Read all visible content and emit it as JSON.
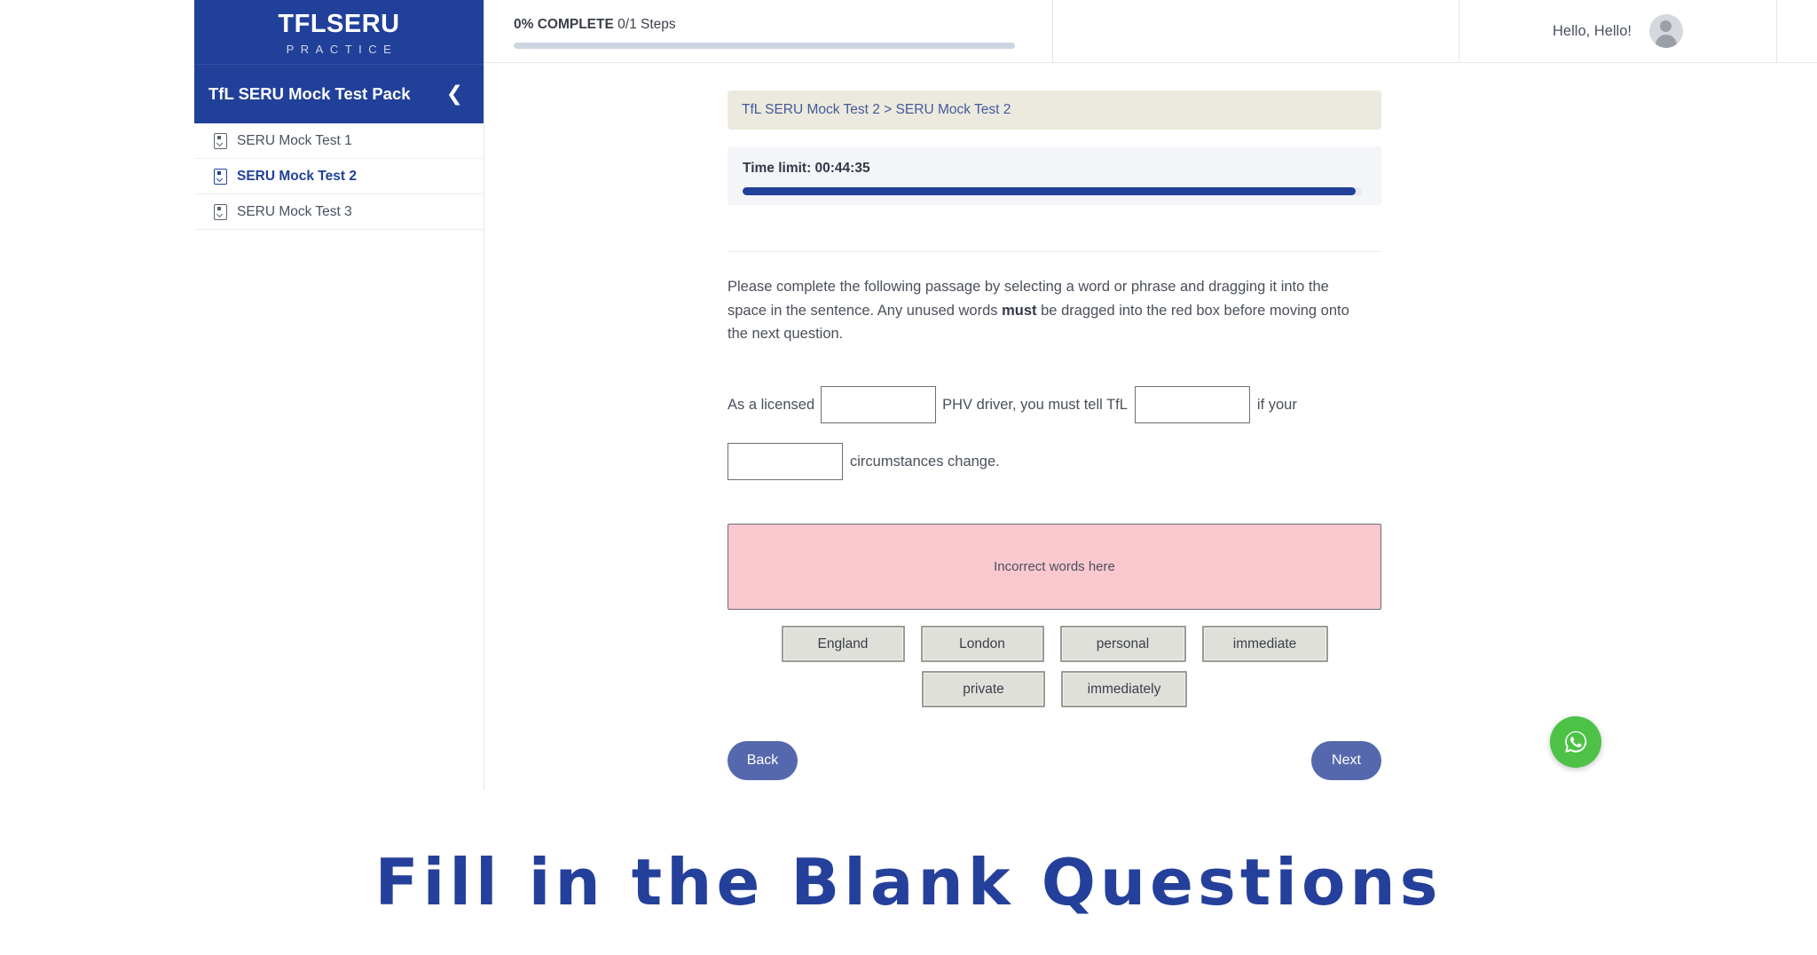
{
  "brand": {
    "name": "TFLSERU",
    "tagline": "PRACTICE"
  },
  "sidebar": {
    "pack_title": "TfL SERU Mock Test Pack",
    "collapse_icon": "chevron-left-icon",
    "items": [
      {
        "label": "SERU Mock Test 1",
        "icon": "document-check-icon",
        "active": false
      },
      {
        "label": "SERU Mock Test 2",
        "icon": "document-check-icon",
        "active": true
      },
      {
        "label": "SERU Mock Test 3",
        "icon": "document-check-icon",
        "active": false
      }
    ]
  },
  "topbar": {
    "progress_percent": "0%",
    "progress_word": "COMPLETE",
    "steps": "0/1 Steps",
    "progress_value": 0,
    "greeting": "Hello, Hello!",
    "avatar_icon": "user-avatar-icon"
  },
  "main": {
    "breadcrumb": "TfL SERU Mock Test 2 > SERU Mock Test 2",
    "timer_label": "Time limit: 00:44:35",
    "timer_progress": 99,
    "instructions_part1": "Please complete the following passage by selecting a word or phrase and dragging it into the space in the sentence. Any unused words ",
    "instructions_bold": "must",
    "instructions_part2": " be dragged into the red box before moving onto the next question.",
    "sentence": {
      "seg1": "As a licensed",
      "blank1_value": "",
      "seg2": "PHV driver, you must tell TfL",
      "blank2_value": "",
      "seg3": "if your",
      "blank3_value": "",
      "seg4": "circumstances change."
    },
    "red_box_label": "Incorrect words here",
    "word_options_row1": [
      "England",
      "London",
      "personal",
      "immediate"
    ],
    "word_options_row2": [
      "private",
      "immediately"
    ],
    "back_label": "Back",
    "next_label": "Next"
  },
  "floating": {
    "whatsapp_icon": "whatsapp-icon"
  },
  "headline": "Fill in the Blank Questions",
  "colors": {
    "brand_blue": "#21409a",
    "button_blue": "#5668ad",
    "breadcrumb_bg": "#eceade",
    "red_box_bg": "#fbc8d0",
    "chip_bg": "#e0e0da",
    "whatsapp_green": "#4dc247",
    "headline_blue": "#25409b"
  }
}
